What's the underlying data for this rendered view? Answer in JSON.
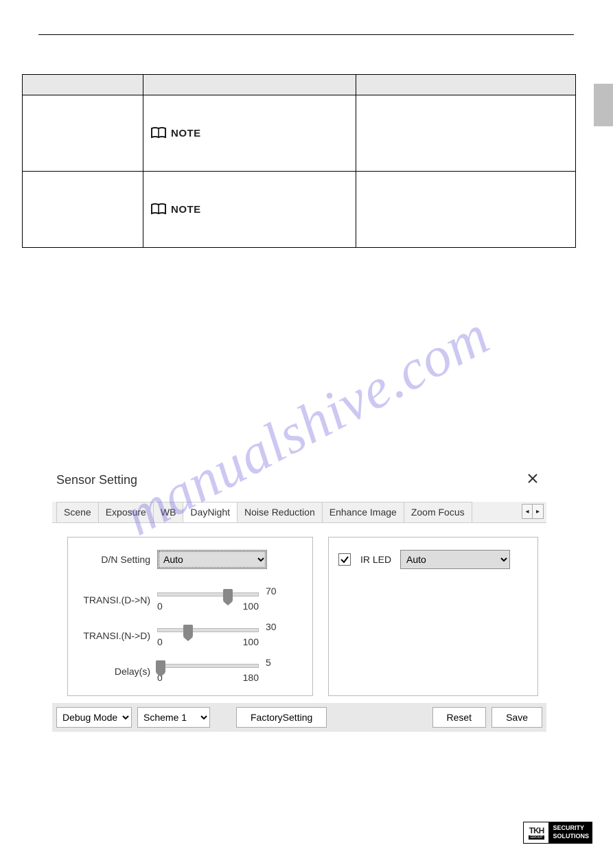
{
  "table": {
    "headers": [
      "",
      "",
      ""
    ],
    "rows": [
      {
        "note_label": "NOTE"
      },
      {
        "note_label": "NOTE"
      }
    ]
  },
  "watermark": "manualshive.com",
  "dialog": {
    "title": "Sensor Setting",
    "tabs": [
      "Scene",
      "Exposure",
      "WB",
      "DayNight",
      "Noise Reduction",
      "Enhance Image",
      "Zoom Focus"
    ],
    "active_tab_index": 3,
    "arrows": {
      "prev": "◂",
      "next": "▸"
    },
    "left_panel": {
      "dn_setting_label": "D/N Setting",
      "dn_setting_value": "Auto",
      "dn_options": [
        "Auto"
      ],
      "trans_dn_label": "TRANSI.(D->N)",
      "trans_dn_value": 70,
      "trans_dn_min": 0,
      "trans_dn_max": 100,
      "trans_nd_label": "TRANSI.(N->D)",
      "trans_nd_value": 30,
      "trans_nd_min": 0,
      "trans_nd_max": 100,
      "delay_label": "Delay(s)",
      "delay_value": 5,
      "delay_min": 0,
      "delay_max": 180
    },
    "right_panel": {
      "ir_led_checked": true,
      "ir_led_label": "IR LED",
      "ir_led_value": "Auto",
      "ir_led_options": [
        "Auto"
      ]
    },
    "bottom": {
      "debug_label": "Debug Mode",
      "scheme_label": "Scheme 1",
      "factory_btn": "FactorySetting",
      "reset_btn": "Reset",
      "save_btn": "Save"
    }
  },
  "footer": {
    "brand_top": "TKH",
    "brand_sub": "GROUP",
    "right_line1": "SECURITY",
    "right_line2": "SOLUTIONS"
  }
}
